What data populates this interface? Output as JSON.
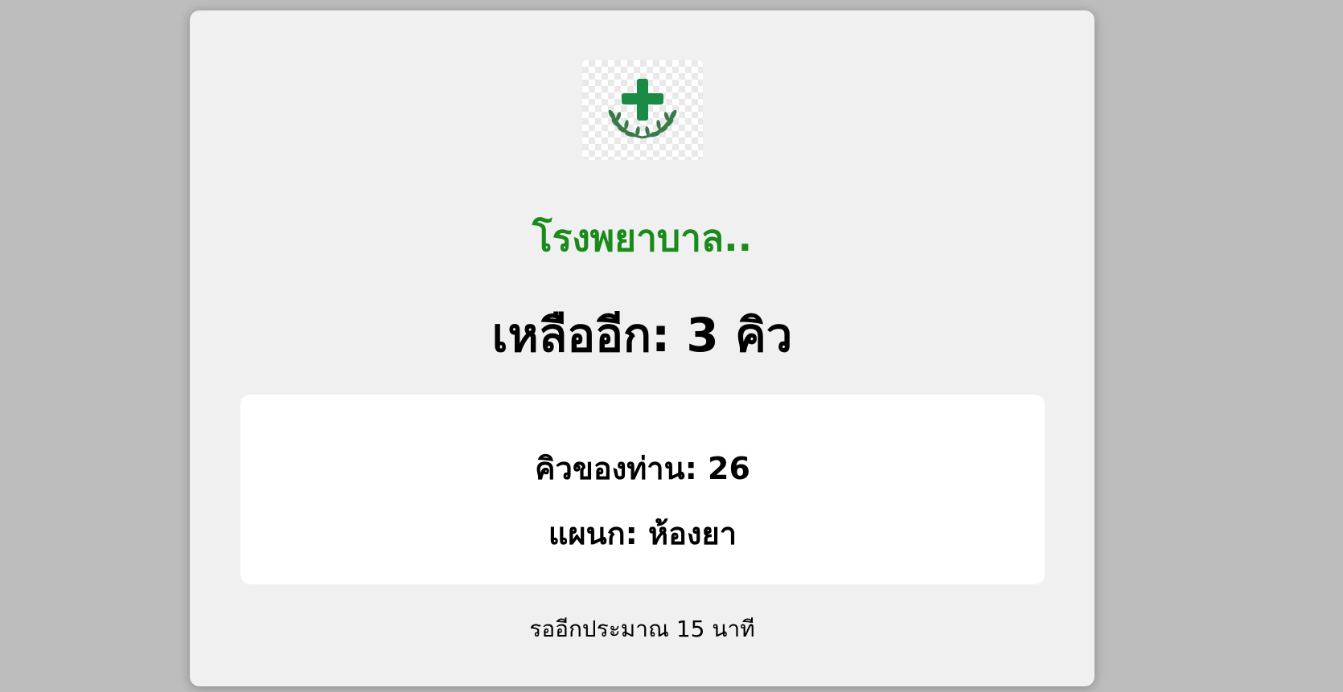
{
  "logo": {
    "icon": "green-cross-laurel-icon",
    "color": "#1a8a44"
  },
  "hospital": {
    "name": "โรงพยาบาล..",
    "color": "#1a8a1a"
  },
  "queue": {
    "remaining_text": "เหลืออีก: 3 คิว",
    "your_queue_text": "คิวของท่าน: 26",
    "department_text": "แผนก: ห้องยา",
    "wait_text": "รออีกประมาณ 15 นาที"
  }
}
